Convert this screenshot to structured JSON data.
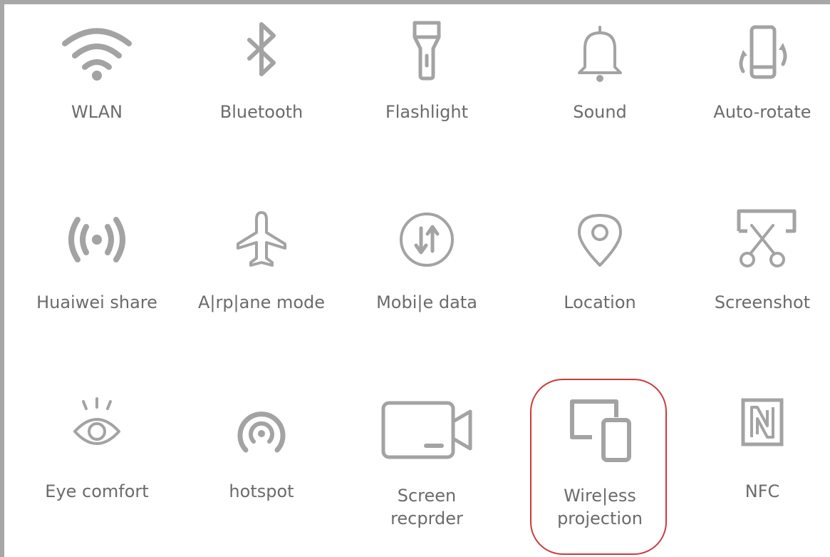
{
  "tiles": [
    {
      "label": "WLAN",
      "icon": "wifi-icon"
    },
    {
      "label": "Bluetooth",
      "icon": "bluetooth-icon"
    },
    {
      "label": "Flashlight",
      "icon": "flashlight-icon"
    },
    {
      "label": "Sound",
      "icon": "bell-icon"
    },
    {
      "label": "Auto-rotate",
      "icon": "auto-rotate-icon"
    },
    {
      "label": "Huaiwei share",
      "icon": "share-waves-icon"
    },
    {
      "label": "A|rp|ane mode",
      "icon": "airplane-icon"
    },
    {
      "label": "Mobi|e data",
      "icon": "mobile-data-icon"
    },
    {
      "label": "Location",
      "icon": "location-pin-icon"
    },
    {
      "label": "Screenshot",
      "icon": "scissors-icon"
    },
    {
      "label": "Eye comfort",
      "icon": "eye-icon"
    },
    {
      "label": "hotspot",
      "icon": "hotspot-icon"
    },
    {
      "label": "Screen\nrecprder",
      "icon": "video-camera-icon"
    },
    {
      "label": "Wire|ess\nprojection",
      "icon": "wireless-projection-icon"
    },
    {
      "label": "NFC",
      "icon": "nfc-icon"
    }
  ],
  "highlight": {
    "tile": "Wire|ess\nprojection",
    "color": "#cc3a3a"
  },
  "colors": {
    "icon": "#a3a3a3",
    "label": "#6b6b6b",
    "border": "#a7a7a7"
  }
}
